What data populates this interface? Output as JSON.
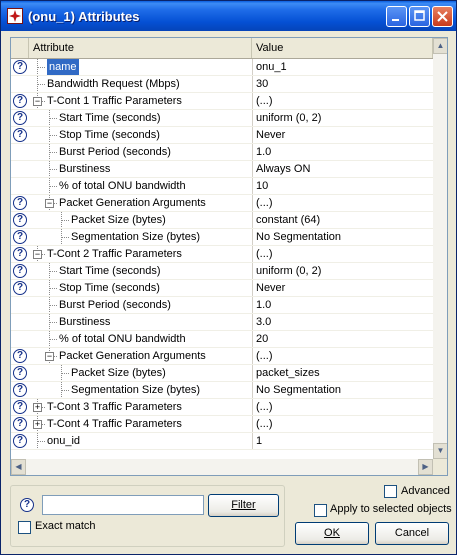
{
  "window": {
    "title": "(onu_1) Attributes"
  },
  "grid": {
    "columns": [
      "Attribute",
      "Value"
    ],
    "rows": [
      {
        "label": "name",
        "value": "onu_1",
        "help": true,
        "selected": true
      },
      {
        "label": "Bandwidth Request (Mbps)",
        "value": "30",
        "help": false
      },
      {
        "label": "T-Cont 1 Traffic Parameters",
        "value": "(...)",
        "help": true,
        "expander": "minus"
      },
      {
        "label": "Start Time (seconds)",
        "value": "uniform (0, 2)",
        "help": true
      },
      {
        "label": "Stop Time (seconds)",
        "value": "Never",
        "help": true
      },
      {
        "label": "Burst Period (seconds)",
        "value": "1.0",
        "help": false
      },
      {
        "label": "Burstiness",
        "value": "Always ON",
        "help": false
      },
      {
        "label": "% of total ONU bandwidth",
        "value": "10",
        "help": false
      },
      {
        "label": "Packet Generation Arguments",
        "value": "(...)",
        "help": true,
        "expander": "minus"
      },
      {
        "label": "Packet Size (bytes)",
        "value": "constant (64)",
        "help": true
      },
      {
        "label": "Segmentation Size (bytes)",
        "value": "No Segmentation",
        "help": true
      },
      {
        "label": "T-Cont 2 Traffic Parameters",
        "value": "(...)",
        "help": true,
        "expander": "minus"
      },
      {
        "label": "Start Time (seconds)",
        "value": "uniform (0, 2)",
        "help": true
      },
      {
        "label": "Stop Time (seconds)",
        "value": "Never",
        "help": true
      },
      {
        "label": "Burst Period (seconds)",
        "value": "1.0",
        "help": false
      },
      {
        "label": "Burstiness",
        "value": "3.0",
        "help": false
      },
      {
        "label": "% of total ONU bandwidth",
        "value": "20",
        "help": false
      },
      {
        "label": "Packet Generation Arguments",
        "value": "(...)",
        "help": true,
        "expander": "minus"
      },
      {
        "label": "Packet Size (bytes)",
        "value": "packet_sizes",
        "help": true
      },
      {
        "label": "Segmentation Size (bytes)",
        "value": "No Segmentation",
        "help": true
      },
      {
        "label": "T-Cont 3 Traffic Parameters",
        "value": "(...)",
        "help": true,
        "expander": "plus"
      },
      {
        "label": "T-Cont 4 Traffic Parameters",
        "value": "(...)",
        "help": true,
        "expander": "plus"
      },
      {
        "label": "onu_id",
        "value": "1",
        "help": true
      }
    ]
  },
  "filter": {
    "input_value": "",
    "filter_button": "Filter",
    "exact_match": "Exact match",
    "advanced": "Advanced",
    "apply_selected": "Apply to selected objects"
  },
  "buttons": {
    "ok": "OK",
    "cancel": "Cancel"
  },
  "colors": {
    "titlebar": "#0550d4",
    "selection": "#316ac5",
    "help_icon": "#15318a"
  }
}
